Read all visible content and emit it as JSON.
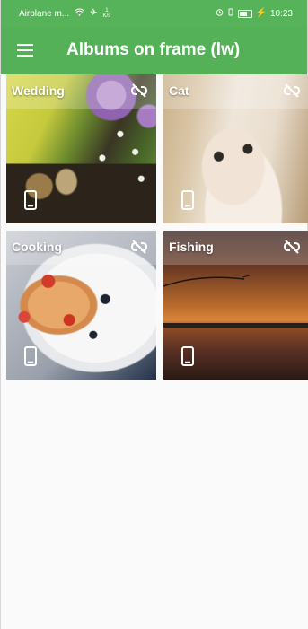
{
  "status_bar": {
    "carrier": "Airplane m...",
    "signal_small": "1",
    "signal_units": "K/s",
    "time": "10:23"
  },
  "app_bar": {
    "menu_icon": "menu-icon",
    "title": "Albums on frame (lw)"
  },
  "albums": [
    {
      "label": "Wedding",
      "link_icon": "link-off-icon",
      "device_icon": "phone-icon"
    },
    {
      "label": "Cat",
      "link_icon": "link-off-icon",
      "device_icon": "phone-icon"
    },
    {
      "label": "Cooking",
      "link_icon": "link-off-icon",
      "device_icon": "phone-icon"
    },
    {
      "label": "Fishing",
      "link_icon": "link-off-icon",
      "device_icon": "phone-icon"
    }
  ],
  "colors": {
    "primary": "#55b158",
    "status_bar": "#57b359",
    "text_on_primary": "#ffffff",
    "background": "#fafafa"
  }
}
